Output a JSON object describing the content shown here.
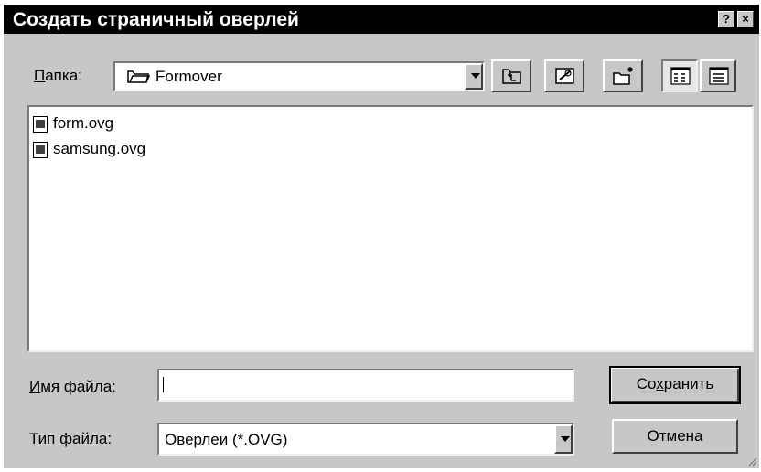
{
  "dialog": {
    "title": "Создать страничный оверлей",
    "help_btn": "?",
    "close_btn": "×"
  },
  "folder": {
    "label_accel": "П",
    "label_rest": "апка:",
    "value": "Formover"
  },
  "toolbar": {
    "icons": [
      "up-one-level-icon",
      "desktop-icon",
      "new-folder-icon",
      "list-view-icon",
      "details-view-icon"
    ]
  },
  "files": [
    {
      "name": "form.ovg"
    },
    {
      "name": "samsung.ovg"
    }
  ],
  "filename": {
    "label_accel": "И",
    "label_rest": "мя файла:",
    "value": ""
  },
  "filetype": {
    "label_accel": "Т",
    "label_rest": "ип файла:",
    "value": "Оверлеи (*.OVG)"
  },
  "buttons": {
    "save_pre": "Со",
    "save_accel": "х",
    "save_post": "ранить",
    "cancel": "Отмена"
  }
}
